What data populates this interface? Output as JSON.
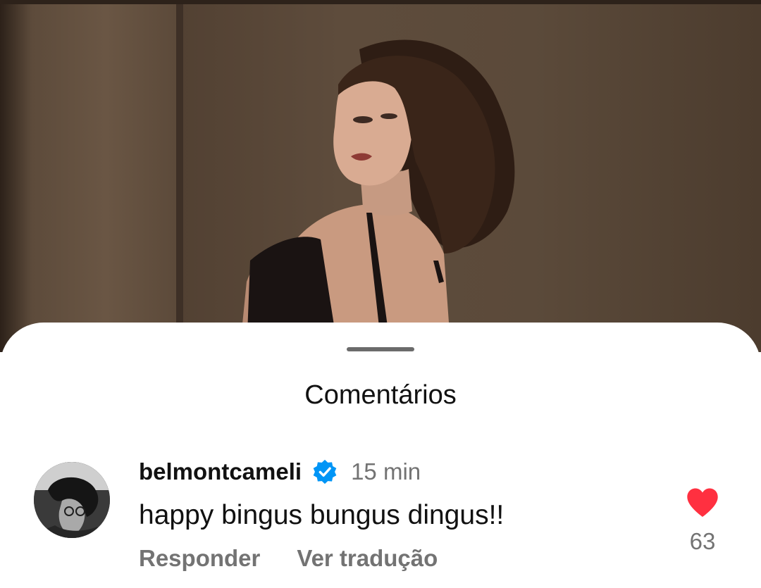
{
  "sheet": {
    "title": "Comentários"
  },
  "comment": {
    "username": "belmontcameli",
    "verified_icon": "verified-badge-icon",
    "timestamp": "15 min",
    "text": "happy bingus bungus dingus!!",
    "actions": {
      "reply_label": "Responder",
      "translate_label": "Ver tradução"
    },
    "like": {
      "icon": "heart-icon",
      "liked": true,
      "count": "63"
    }
  },
  "colors": {
    "heart": "#ff3040",
    "verified": "#0095f6",
    "secondary_text": "#737373",
    "primary_text": "#111111",
    "sheet_background": "#ffffff"
  }
}
